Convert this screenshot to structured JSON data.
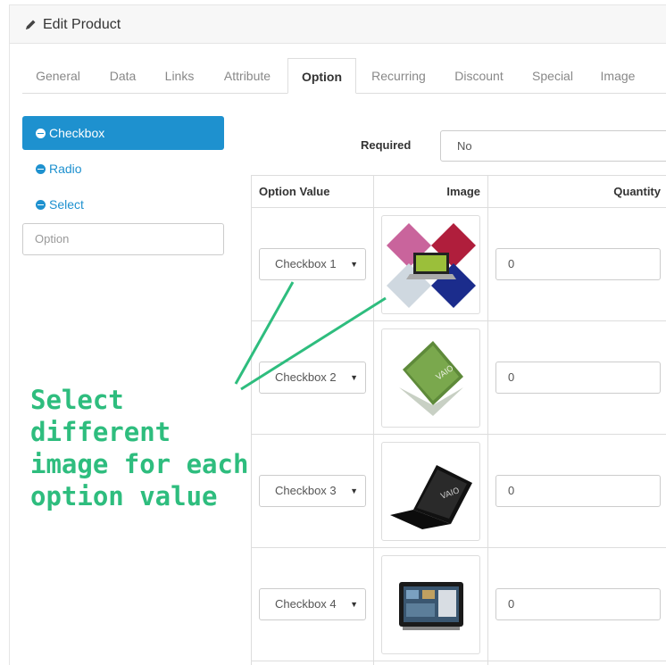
{
  "header": {
    "title": "Edit Product",
    "icon": "pencil-icon"
  },
  "tabs": [
    {
      "label": "General",
      "active": false
    },
    {
      "label": "Data",
      "active": false
    },
    {
      "label": "Links",
      "active": false
    },
    {
      "label": "Attribute",
      "active": false
    },
    {
      "label": "Option",
      "active": true
    },
    {
      "label": "Recurring",
      "active": false
    },
    {
      "label": "Discount",
      "active": false
    },
    {
      "label": "Special",
      "active": false
    },
    {
      "label": "Image",
      "active": false
    }
  ],
  "sidebar": {
    "options": [
      {
        "label": "Checkbox",
        "active": true,
        "icon": "minus-circle-icon"
      },
      {
        "label": "Radio",
        "active": false,
        "icon": "minus-circle-icon"
      },
      {
        "label": "Select",
        "active": false,
        "icon": "minus-circle-icon"
      }
    ],
    "option_input_placeholder": "Option"
  },
  "required": {
    "label": "Required",
    "value": "No"
  },
  "table": {
    "headers": {
      "option_value": "Option Value",
      "image": "Image",
      "quantity": "Quantity"
    },
    "rows": [
      {
        "option_value": "Checkbox 1",
        "image": "multicolor laptops",
        "quantity": "0"
      },
      {
        "option_value": "Checkbox 2",
        "image": "green laptop",
        "quantity": "0"
      },
      {
        "option_value": "Checkbox 3",
        "image": "black laptop",
        "quantity": "0"
      },
      {
        "option_value": "Checkbox 4",
        "image": "tablet",
        "quantity": "0"
      }
    ]
  },
  "annotation": {
    "line1": "Select different",
    "line2": "image for each",
    "line3": "option value"
  },
  "colors": {
    "accent": "#1e91cf",
    "annotation": "#2ebd7e",
    "border": "#dddddd"
  }
}
